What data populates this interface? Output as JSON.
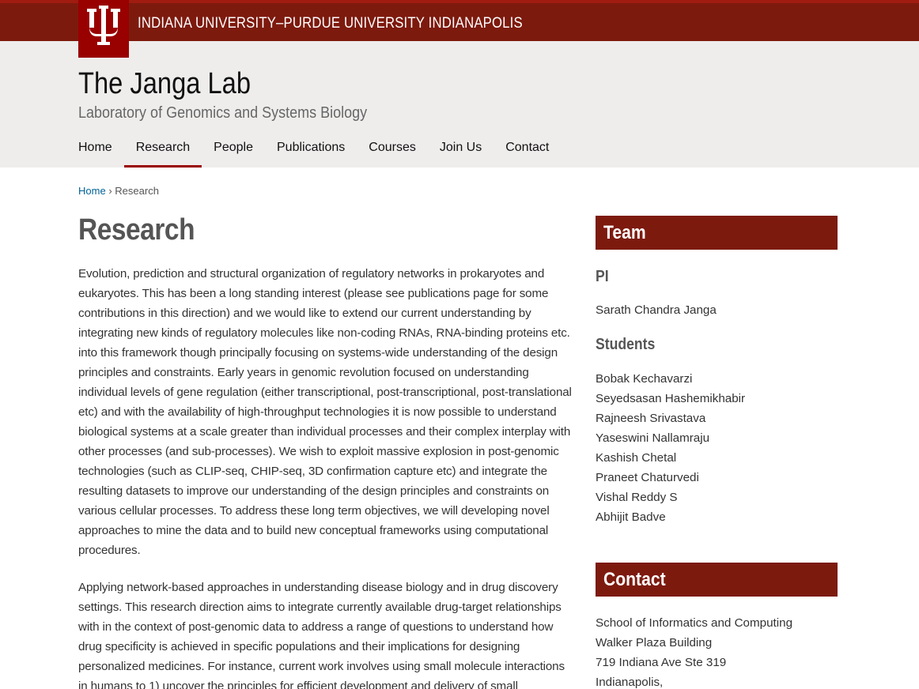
{
  "topbar": {
    "university_name": "INDIANA UNIVERSITY–PURDUE UNIVERSITY INDIANAPOLIS",
    "brand_color": "#7d1a0e"
  },
  "header": {
    "title": "The Janga Lab",
    "subtitle": "Laboratory of Genomics and Systems Biology"
  },
  "nav": {
    "items": [
      {
        "label": "Home",
        "active": false
      },
      {
        "label": "Research",
        "active": true
      },
      {
        "label": "People",
        "active": false
      },
      {
        "label": "Publications",
        "active": false
      },
      {
        "label": "Courses",
        "active": false
      },
      {
        "label": "Join Us",
        "active": false
      },
      {
        "label": "Contact",
        "active": false
      }
    ]
  },
  "breadcrumb": {
    "home": "Home",
    "separator": "›",
    "current": "Research"
  },
  "main": {
    "title": "Research",
    "paragraphs": [
      "Evolution, prediction and structural organization of regulatory networks in prokaryotes and eukaryotes. This has been a long standing interest (please see publications page for some contributions in this direction) and we would like to extend our current understanding by integrating new kinds of regulatory molecules like non-coding RNAs, RNA-binding proteins etc. into this framework though principally focusing on systems-wide understanding of the design principles and constraints. Early years in genomic revolution focused on understanding individual levels of gene regulation (either transcriptional, post-transcriptional, post-translational etc) and with the availability of high-throughput technologies it is now possible to understand biological systems at a scale greater than individual processes and their complex interplay with other processes (and sub-processes). We wish to exploit massive explosion in post-genomic technologies (such as CLIP-seq, CHIP-seq, 3D confirmation capture etc) and integrate the resulting datasets to improve our understanding of the design principles and constraints on various cellular processes. To address these long term objectives, we will developing novel approaches to mine the data and to build new conceptual frameworks using computational procedures.",
      "Applying network-based approaches in understanding disease biology and in drug discovery settings. This research direction aims to integrate currently available drug-target relationships with in the context of post-genomic data to address a range of questions to understand how drug specificity is achieved in specific populations and their implications for designing personalized medicines. For instance, current work involves using small molecule interactions in humans to 1) uncover the principles for efficient development and delivery of small"
    ]
  },
  "sidebar": {
    "team": {
      "heading": "Team",
      "pi_heading": "PI",
      "pi": [
        "Sarath Chandra Janga"
      ],
      "students_heading": "Students",
      "students": [
        "Bobak Kechavarzi",
        "Seyedsasan Hashemikhabir",
        "Rajneesh Srivastava",
        "Yaseswini Nallamraju",
        "Kashish Chetal",
        "Praneet Chaturvedi",
        "Vishal Reddy S",
        "Abhijit Badve"
      ]
    },
    "contact": {
      "heading": "Contact",
      "lines": [
        "School of Informatics and Computing",
        "Walker Plaza Building",
        "719 Indiana Ave Ste 319",
        "Indianapolis,"
      ]
    }
  }
}
